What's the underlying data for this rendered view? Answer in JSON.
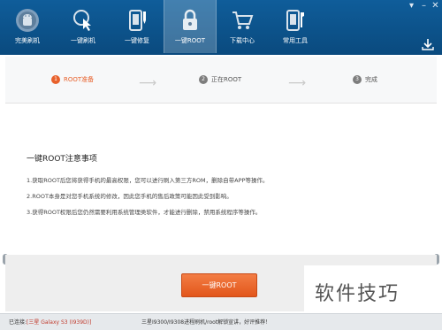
{
  "nav": {
    "items": [
      {
        "label": "完美刷机",
        "icon": "android-robot-icon"
      },
      {
        "label": "一键刷机",
        "icon": "touch-flash-icon"
      },
      {
        "label": "一键修复",
        "icon": "phone-repair-icon"
      },
      {
        "label": "一键ROOT",
        "icon": "lock-icon"
      },
      {
        "label": "下载中心",
        "icon": "shopping-cart-icon"
      },
      {
        "label": "常用工具",
        "icon": "phone-tools-icon"
      }
    ],
    "active": "一键ROOT"
  },
  "steps": [
    {
      "num": "1",
      "label": "ROOT准备",
      "state": "active"
    },
    {
      "num": "2",
      "label": "正在ROOT",
      "state": "pending"
    },
    {
      "num": "3",
      "label": "完成",
      "state": "pending"
    }
  ],
  "notice": {
    "title": "一键ROOT注意事项",
    "lines": [
      "1.获取ROOT后您将获得手机的最高权限，您可以进行刷入第三方ROM，删除自带APP等操作。",
      "2.ROOT本身是对您手机系统的修改，因此您手机的售后政策可能因此受到影响。",
      "3.获得ROOT权限后您仍然需要利用系统管理类软件，才能进行删除，禁用系统程序等操作。"
    ]
  },
  "root_button": "一键ROOT",
  "watermark": "软件技巧",
  "status": {
    "connected_prefix": "已连接:",
    "device": "[三星 Galaxy S3 (I939D)]",
    "info": "三星I9300/I9308进程刷机/root解锁宣讲，好评推荐！"
  },
  "colors": {
    "titlebar": "#0f5d9a",
    "accent": "#e8612c",
    "step_inactive": "#7d7d7d"
  }
}
